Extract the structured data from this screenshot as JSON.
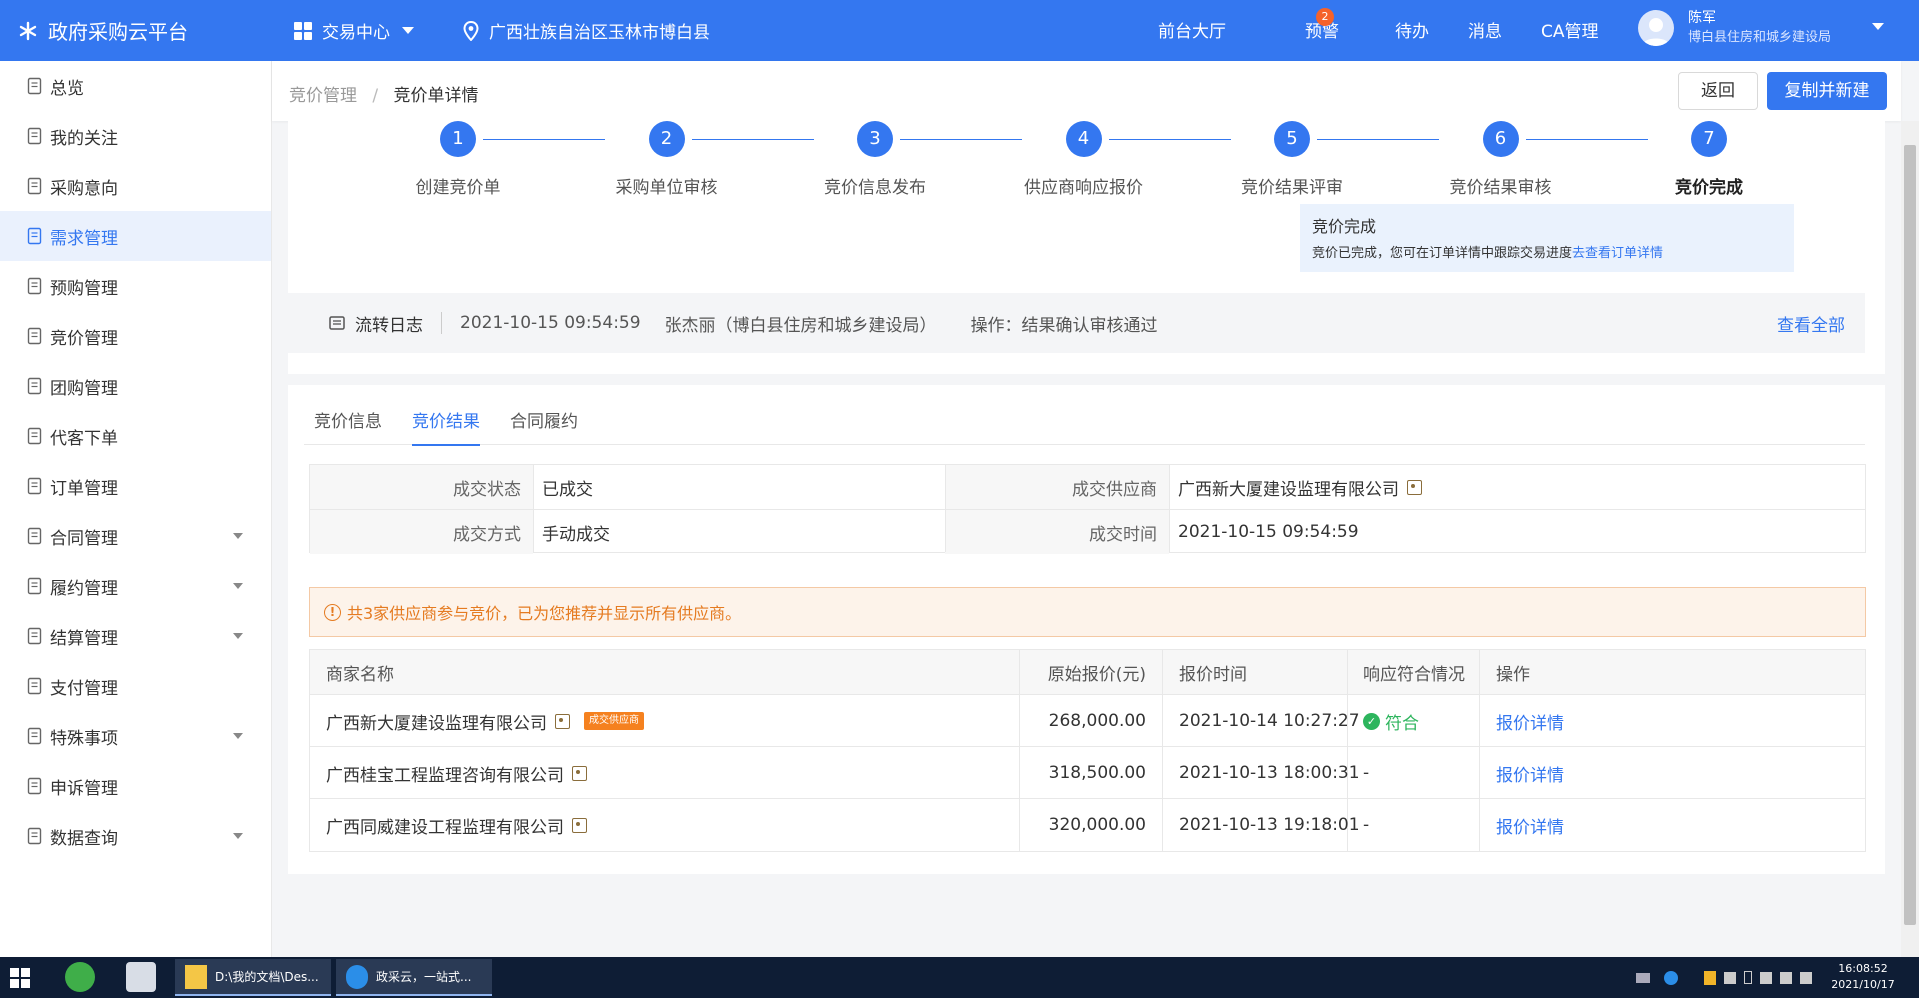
{
  "app": {
    "title": "政府采购云平台",
    "trade_center": "交易中心",
    "location": "广西壮族自治区玉林市博白县",
    "links": [
      "前台大厅",
      "预警",
      "待办",
      "消息",
      "CA管理"
    ],
    "warning_badge": "2",
    "user_name": "陈军",
    "user_org": "博白县住房和城乡建设局"
  },
  "sidebar": {
    "items": [
      {
        "label": "总览",
        "icon": "home-icon"
      },
      {
        "label": "我的关注",
        "icon": "users-icon"
      },
      {
        "label": "采购意向",
        "icon": "doc-edit-icon"
      },
      {
        "label": "需求管理",
        "icon": "doc-icon"
      },
      {
        "label": "预购管理",
        "icon": "cart-doc-icon"
      },
      {
        "label": "竞价管理",
        "icon": "bid-icon"
      },
      {
        "label": "团购管理",
        "icon": "group-icon"
      },
      {
        "label": "代客下单",
        "icon": "proxy-icon"
      },
      {
        "label": "订单管理",
        "icon": "order-icon"
      },
      {
        "label": "合同管理",
        "icon": "contract-icon"
      },
      {
        "label": "履约管理",
        "icon": "perform-icon"
      },
      {
        "label": "结算管理",
        "icon": "settle-icon"
      },
      {
        "label": "支付管理",
        "icon": "pay-icon"
      },
      {
        "label": "特殊事项",
        "icon": "special-icon"
      },
      {
        "label": "申诉管理",
        "icon": "appeal-icon"
      },
      {
        "label": "数据查询",
        "icon": "data-icon"
      }
    ],
    "active_index": 3
  },
  "breadcrumb": {
    "parent": "竞价管理",
    "separator": "/",
    "current": "竞价单详情"
  },
  "buttons": {
    "back": "返回",
    "copy_new": "复制并新建"
  },
  "steps": [
    {
      "num": "1",
      "label": "创建竞价单"
    },
    {
      "num": "2",
      "label": "采购单位审核"
    },
    {
      "num": "3",
      "label": "竞价信息发布"
    },
    {
      "num": "4",
      "label": "供应商响应报价"
    },
    {
      "num": "5",
      "label": "竞价结果评审"
    },
    {
      "num": "6",
      "label": "竞价结果审核"
    },
    {
      "num": "7",
      "label": "竞价完成"
    }
  ],
  "done_tip": {
    "title": "竞价完成",
    "desc": "竞价已完成，您可在订单详情中跟踪交易进度",
    "link": "去查看订单详情"
  },
  "log": {
    "title": "流转日志",
    "time": "2021-10-15 09:54:59",
    "who": "张杰丽（博白县住房和城乡建设局）",
    "op": "操作：结果确认审核通过",
    "view_all": "查看全部"
  },
  "tabs": [
    "竞价信息",
    "竞价结果",
    "合同履约"
  ],
  "result": {
    "status_label": "成交状态",
    "status": "已成交",
    "supplier_label": "成交供应商",
    "supplier": "广西新大厦建设监理有限公司",
    "method_label": "成交方式",
    "method": "手动成交",
    "time_label": "成交时间",
    "time": "2021-10-15 09:54:59"
  },
  "warning": "共3家供应商参与竞价，已为您推荐并显示所有供应商。",
  "table": {
    "headers": [
      "商家名称",
      "原始报价(元)",
      "报价时间",
      "响应符合情况",
      "操作"
    ],
    "rows": [
      {
        "name": "广西新大厦建设监理有限公司",
        "tag": "成交供应商",
        "price": "268,000.00",
        "time": "2021-10-14 10:27:27",
        "match": "符合",
        "action": "报价详情"
      },
      {
        "name": "广西桂宝工程监理咨询有限公司",
        "tag": "",
        "price": "318,500.00",
        "time": "2021-10-13 18:00:31",
        "match": "-",
        "action": "报价详情"
      },
      {
        "name": "广西同威建设工程监理有限公司",
        "tag": "",
        "price": "320,000.00",
        "time": "2021-10-13 19:18:01",
        "match": "-",
        "action": "报价详情"
      }
    ]
  },
  "taskbar": {
    "win1": "D:\\我的文档\\Des...",
    "win2": "政采云，一站式...",
    "time": "16:08:52",
    "date": "2021/10/17"
  },
  "colors": {
    "primary": "#3477f0",
    "warning": "#e57b21",
    "success": "#2db55d"
  }
}
